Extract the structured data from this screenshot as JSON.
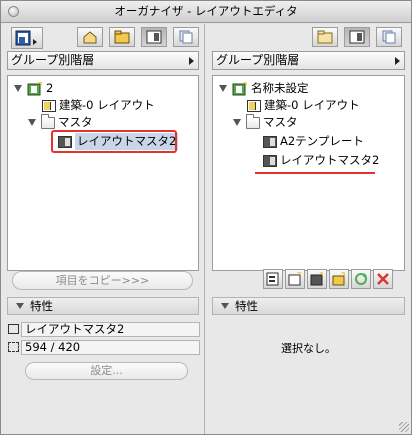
{
  "window": {
    "title": "オーガナイザ - レイアウトエディタ"
  },
  "left": {
    "group_selector": "グループ別階層",
    "tree": {
      "root": "2",
      "items": [
        {
          "label": "建築-0 レイアウト",
          "icon": "layout-page-icon"
        },
        {
          "label": "マスタ",
          "icon": "folder-icon"
        },
        {
          "label": "レイアウトマスタ2",
          "icon": "master-layout-icon",
          "selected": true
        }
      ]
    },
    "copy_button": "項目をコピー>>>",
    "properties": {
      "header": "特性",
      "name": "レイアウトマスタ2",
      "size": "594 / 420",
      "settings_button": "設定..."
    }
  },
  "right": {
    "group_selector": "グループ別階層",
    "tree": {
      "root": "名称未設定",
      "items": [
        {
          "label": "建築-0 レイアウト",
          "icon": "layout-page-icon"
        },
        {
          "label": "マスタ",
          "icon": "folder-icon"
        },
        {
          "label": "A2テンプレート",
          "icon": "master-layout-icon"
        },
        {
          "label": "レイアウトマスタ2",
          "icon": "master-layout-icon"
        }
      ]
    },
    "properties": {
      "header": "特性",
      "empty_text": "選択なし。"
    }
  },
  "colors": {
    "highlight": "#e0352e",
    "selection": "#c9d6ea"
  }
}
